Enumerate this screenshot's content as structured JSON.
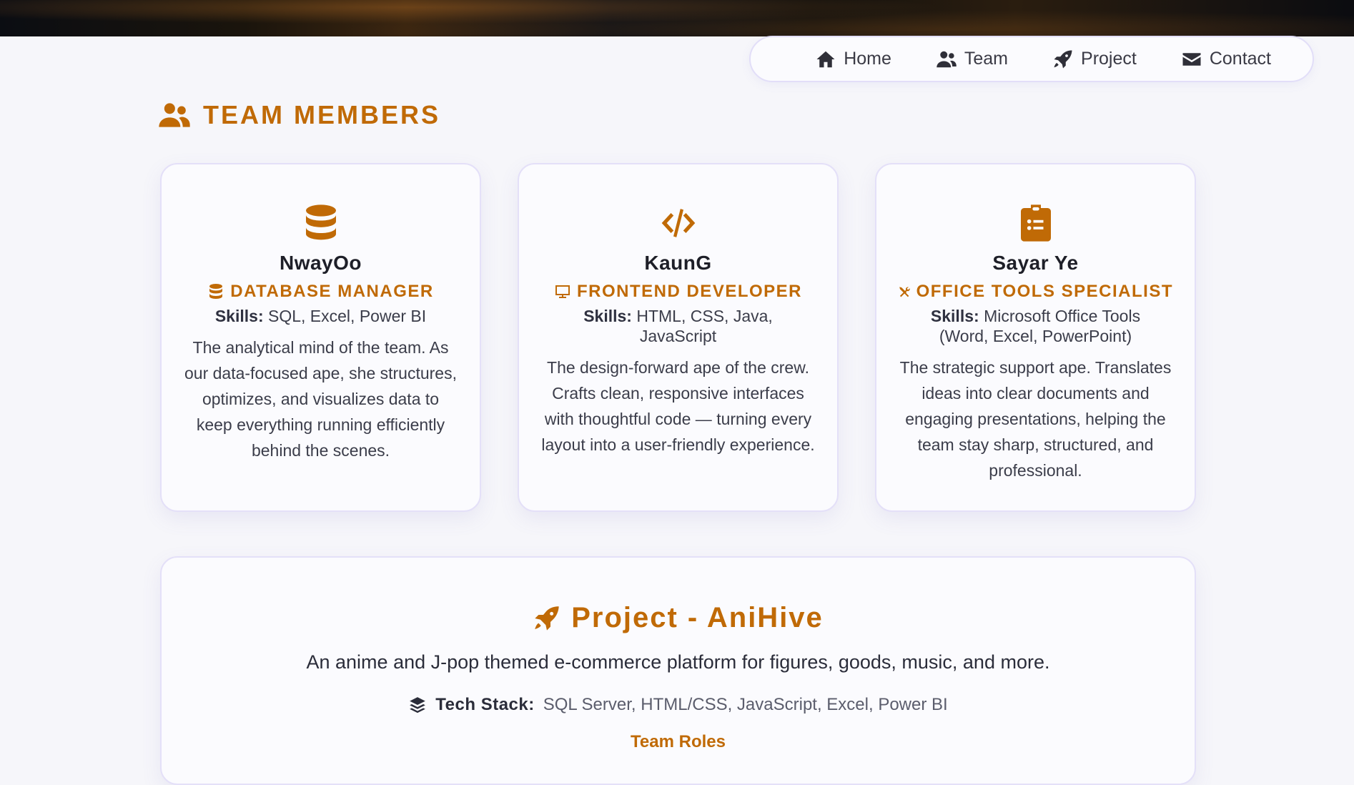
{
  "nav": {
    "items": [
      {
        "label": "Home",
        "icon": "home-icon"
      },
      {
        "label": "Team",
        "icon": "users-icon"
      },
      {
        "label": "Project",
        "icon": "rocket-icon"
      },
      {
        "label": "Contact",
        "icon": "envelope-icon"
      }
    ]
  },
  "section": {
    "title": "TEAM MEMBERS",
    "icon": "users-icon"
  },
  "members": [
    {
      "name": "NwayOo",
      "role": "DATABASE MANAGER",
      "main_icon": "database-icon",
      "role_icon": "database-icon",
      "skills_label": "Skills:",
      "skills": "SQL, Excel, Power BI",
      "description": "The analytical mind of the team. As our data-focused ape, she structures, optimizes, and visualizes data to keep everything running efficiently behind the scenes."
    },
    {
      "name": "KaunG",
      "role": "FRONTEND DEVELOPER",
      "main_icon": "code-icon",
      "role_icon": "desktop-icon",
      "skills_label": "Skills:",
      "skills": "HTML, CSS, Java, JavaScript",
      "description": "The design-forward ape of the crew. Crafts clean, responsive interfaces with thoughtful code — turning every layout into a user-friendly experience."
    },
    {
      "name": "Sayar Ye",
      "role": "OFFICE TOOLS SPECIALIST",
      "main_icon": "clipboard-list-icon",
      "role_icon": "tools-icon",
      "skills_label": "Skills:",
      "skills": "Microsoft Office Tools (Word, Excel, PowerPoint)",
      "description": "The strategic support ape. Translates ideas into clear documents and engaging presentations, helping the team stay sharp, structured, and professional."
    }
  ],
  "project": {
    "title": "Project - AniHive",
    "icon": "rocket-icon",
    "description": "An anime and J-pop themed e-commerce platform for figures, goods, music, and more.",
    "tech_stack_label": "Tech Stack:",
    "tech_stack_icon": "layer-group-icon",
    "tech_stack": "SQL Server, HTML/CSS, JavaScript, Excel, Power BI",
    "team_roles_label": "Team Roles"
  },
  "colors": {
    "accent": "#c06a06",
    "background": "#f6f6fa",
    "card_border": "#e4e0f8"
  }
}
